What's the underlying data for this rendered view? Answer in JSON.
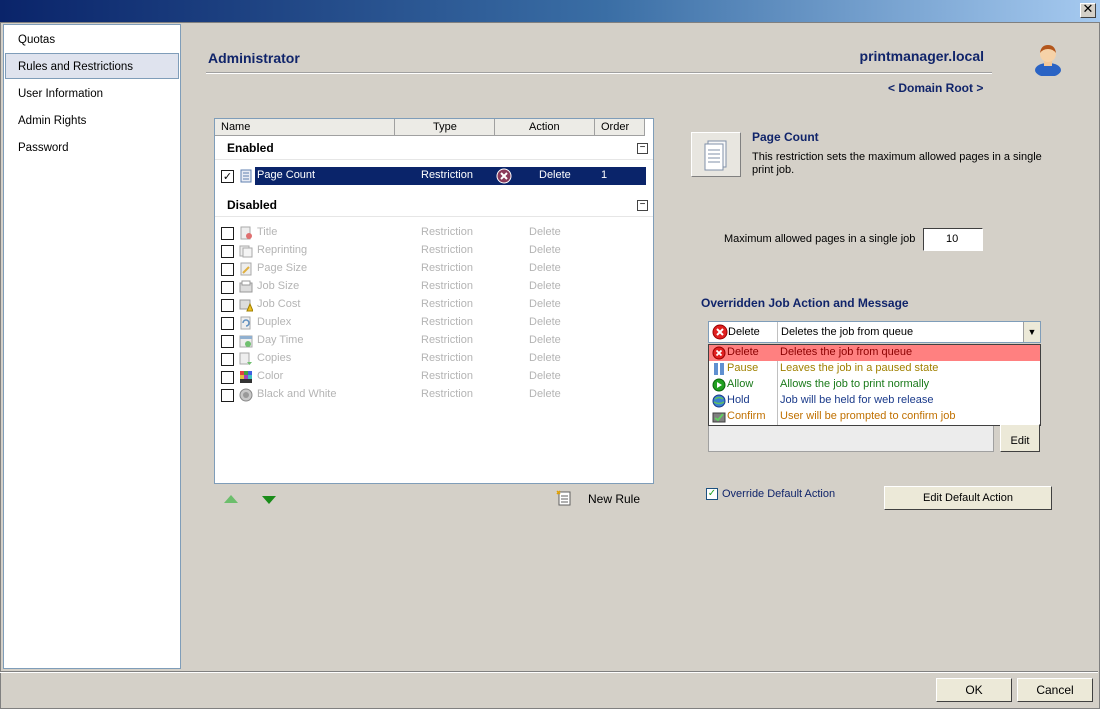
{
  "window": {
    "close_glyph": "✕"
  },
  "sidebar": {
    "items": [
      {
        "label": "Quotas",
        "active": false
      },
      {
        "label": "Rules and Restrictions",
        "active": true
      },
      {
        "label": "User Information",
        "active": false
      },
      {
        "label": "Admin Rights",
        "active": false
      },
      {
        "label": "Password",
        "active": false
      }
    ]
  },
  "header": {
    "title": "Administrator",
    "host": "printmanager.local",
    "domain_link": "< Domain Root >"
  },
  "rules_table": {
    "columns": [
      "Name",
      "Type",
      "Action",
      "Order"
    ],
    "enabled_group": "Enabled",
    "disabled_group": "Disabled",
    "collapse_glyph": "−",
    "enabled_rules": [
      {
        "name": "Page Count",
        "type": "Restriction",
        "action": "Delete",
        "order": "1",
        "checked": true,
        "icon": "page-count-icon"
      }
    ],
    "disabled_rules": [
      {
        "name": "Title",
        "type": "Restriction",
        "action": "Delete",
        "icon": "title-icon"
      },
      {
        "name": "Reprinting",
        "type": "Restriction",
        "action": "Delete",
        "icon": "reprinting-icon"
      },
      {
        "name": "Page Size",
        "type": "Restriction",
        "action": "Delete",
        "icon": "page-size-icon"
      },
      {
        "name": "Job Size",
        "type": "Restriction",
        "action": "Delete",
        "icon": "job-size-icon"
      },
      {
        "name": "Job Cost",
        "type": "Restriction",
        "action": "Delete",
        "icon": "job-cost-icon"
      },
      {
        "name": "Duplex",
        "type": "Restriction",
        "action": "Delete",
        "icon": "duplex-icon"
      },
      {
        "name": "Day Time",
        "type": "Restriction",
        "action": "Delete",
        "icon": "day-time-icon"
      },
      {
        "name": "Copies",
        "type": "Restriction",
        "action": "Delete",
        "icon": "copies-icon"
      },
      {
        "name": "Color",
        "type": "Restriction",
        "action": "Delete",
        "icon": "color-icon"
      },
      {
        "name": "Black and White",
        "type": "Restriction",
        "action": "Delete",
        "icon": "black-and-white-icon"
      }
    ]
  },
  "toolbar": {
    "new_rule_label": "New Rule"
  },
  "detail": {
    "title": "Page Count",
    "description": "This restriction sets the maximum allowed pages in a single print job.",
    "max_label": "Maximum allowed pages in a single job",
    "max_value": "10"
  },
  "override": {
    "title": "Overridden Job Action and Message",
    "selected_name": "Delete",
    "selected_desc": "Deletes the job from queue",
    "options": [
      {
        "name": "Delete",
        "desc": "Deletes the job from queue",
        "color": "#8b0000",
        "icon": "delete-icon"
      },
      {
        "name": "Pause",
        "desc": "Leaves the job in a paused state",
        "color": "#a08000",
        "icon": "pause-icon"
      },
      {
        "name": "Allow",
        "desc": "Allows the job to print normally",
        "color": "#1a7a1a",
        "icon": "allow-icon"
      },
      {
        "name": "Hold",
        "desc": "Job will be held for web release",
        "color": "#1a3a8a",
        "icon": "hold-icon"
      },
      {
        "name": "Confirm",
        "desc": "User will be prompted to confirm job",
        "color": "#c07000",
        "icon": "confirm-icon"
      }
    ],
    "edit_label": "Edit",
    "override_default_label": "Override Default Action",
    "override_default_checked": true,
    "edit_default_label": "Edit Default Action"
  },
  "footer": {
    "ok_label": "OK",
    "cancel_label": "Cancel"
  },
  "colors": {
    "accent": "#10246a",
    "selection": "#0a246a",
    "highlight": "#ff8080",
    "disabled_text": "#b4b4b4"
  }
}
